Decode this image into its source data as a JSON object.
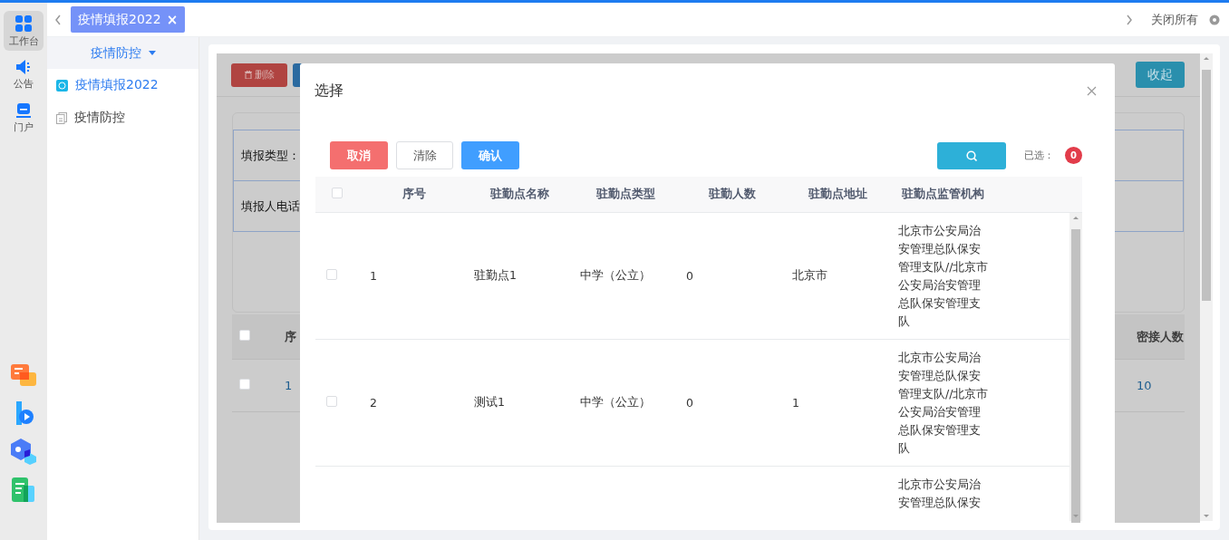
{
  "rail": {
    "items": [
      {
        "label": "工作台",
        "kind": "grid",
        "selected": true
      },
      {
        "label": "公告",
        "kind": "speaker",
        "selected": false
      },
      {
        "label": "门户",
        "kind": "monitor",
        "selected": false
      }
    ]
  },
  "tab_bar": {
    "tabs": [
      {
        "label": "疫情填报2022",
        "close_glyph": "×",
        "selected": true
      }
    ],
    "close_all": "关闭所有"
  },
  "side_menu": {
    "title": "疫情防控",
    "items": [
      {
        "label": "疫情填报2022",
        "kind": "form",
        "selected": true
      },
      {
        "label": "疫情防控",
        "kind": "doc",
        "selected": false
      }
    ]
  },
  "background": {
    "delete_button": "删除",
    "collapse_button": "收起",
    "form_labels": [
      "填报类型：",
      "填报人电话"
    ],
    "table": {
      "columns": [
        "序",
        "密接人数"
      ],
      "all_checked": false,
      "rows": [
        {
          "checked": false,
          "cells": [
            "1",
            "10"
          ]
        }
      ]
    }
  },
  "dialog": {
    "title": "选择",
    "buttons": [
      {
        "label": "取消",
        "kind": "danger"
      },
      {
        "label": "清除",
        "kind": "plain"
      },
      {
        "label": "确认",
        "kind": "primary"
      }
    ],
    "selected_label": "已选：",
    "selected_count": "0",
    "table": {
      "all_checked": false,
      "columns": [
        "序号",
        "驻勤点名称",
        "驻勤点类型",
        "驻勤人数",
        "驻勤点地址",
        "驻勤点监管机构"
      ],
      "rows": [
        {
          "checked": false,
          "cells": [
            "1",
            "驻勤点1",
            "中学（公立）",
            "0",
            "北京市",
            "北京市公安局治安管理总队保安管理支队//北京市公安局治安管理总队保安管理支队"
          ]
        },
        {
          "checked": false,
          "cells": [
            "2",
            "测试1",
            "中学（公立）",
            "0",
            "1",
            "北京市公安局治安管理总队保安管理支队//北京市公安局治安管理总队保安管理支队"
          ]
        },
        {
          "cells": [
            "",
            "",
            "",
            "",
            "",
            "北京市公安局治安管理总队保安"
          ]
        }
      ]
    }
  }
}
